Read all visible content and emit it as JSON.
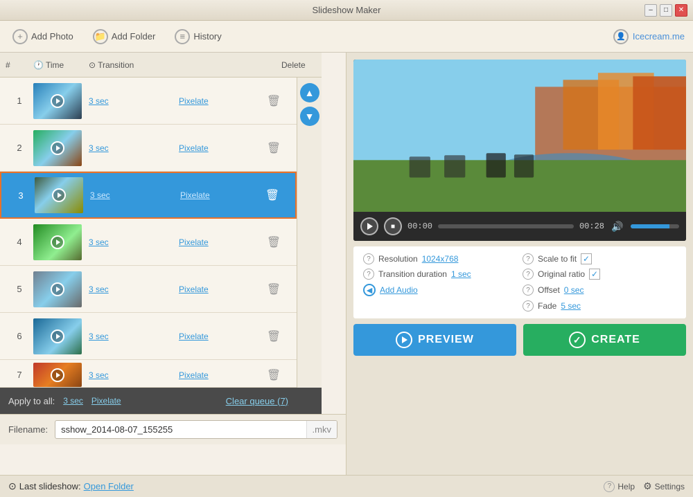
{
  "app": {
    "title": "Slideshow Maker",
    "branding": "Icecream.me"
  },
  "titlebar": {
    "minimize": "–",
    "maximize": "□",
    "close": "✕"
  },
  "toolbar": {
    "add_photo": "Add Photo",
    "add_folder": "Add Folder",
    "history": "History"
  },
  "table": {
    "col_num": "#",
    "col_time": "Time",
    "col_transition": "Transition",
    "col_delete": "Delete"
  },
  "slides": [
    {
      "num": "1",
      "time": "3 sec",
      "transition": "Pixelate",
      "thumb_class": "thumb-1",
      "selected": false
    },
    {
      "num": "2",
      "time": "3 sec",
      "transition": "Pixelate",
      "thumb_class": "thumb-2",
      "selected": false
    },
    {
      "num": "3",
      "time": "3 sec",
      "transition": "Pixelate",
      "thumb_class": "thumb-3",
      "selected": true
    },
    {
      "num": "4",
      "time": "3 sec",
      "transition": "Pixelate",
      "thumb_class": "thumb-4",
      "selected": false
    },
    {
      "num": "5",
      "time": "3 sec",
      "transition": "Pixelate",
      "thumb_class": "thumb-5",
      "selected": false
    },
    {
      "num": "6",
      "time": "3 sec",
      "transition": "Pixelate",
      "thumb_class": "thumb-6",
      "selected": false
    },
    {
      "num": "7",
      "time": "3 sec",
      "transition": "Pixelate",
      "thumb_class": "thumb-7",
      "selected": false
    }
  ],
  "apply_bar": {
    "label": "Apply to all:",
    "time": "3 sec",
    "transition": "Pixelate",
    "clear": "Clear queue (7)"
  },
  "filename": {
    "label": "Filename:",
    "value": "sshow_2014-08-07_155255",
    "extension": ".mkv"
  },
  "status": {
    "text": "Last slideshow: Open Folder"
  },
  "video": {
    "time_current": "00:00",
    "time_total": "00:28"
  },
  "settings": {
    "resolution_label": "Resolution",
    "resolution_value": "1024x768",
    "scale_label": "Scale to fit",
    "scale_checked": true,
    "transition_label": "Transition duration",
    "transition_value": "1 sec",
    "original_ratio_label": "Original ratio",
    "original_ratio_checked": true,
    "offset_label": "Offset",
    "offset_value": "0 sec",
    "fade_label": "Fade",
    "fade_value": "5 sec",
    "add_audio": "Add Audio"
  },
  "buttons": {
    "preview": "PREVIEW",
    "create": "CREATE"
  },
  "bottom": {
    "help": "Help",
    "settings": "Settings",
    "last_slideshow": "Last slideshow:",
    "open_folder": "Open Folder"
  }
}
